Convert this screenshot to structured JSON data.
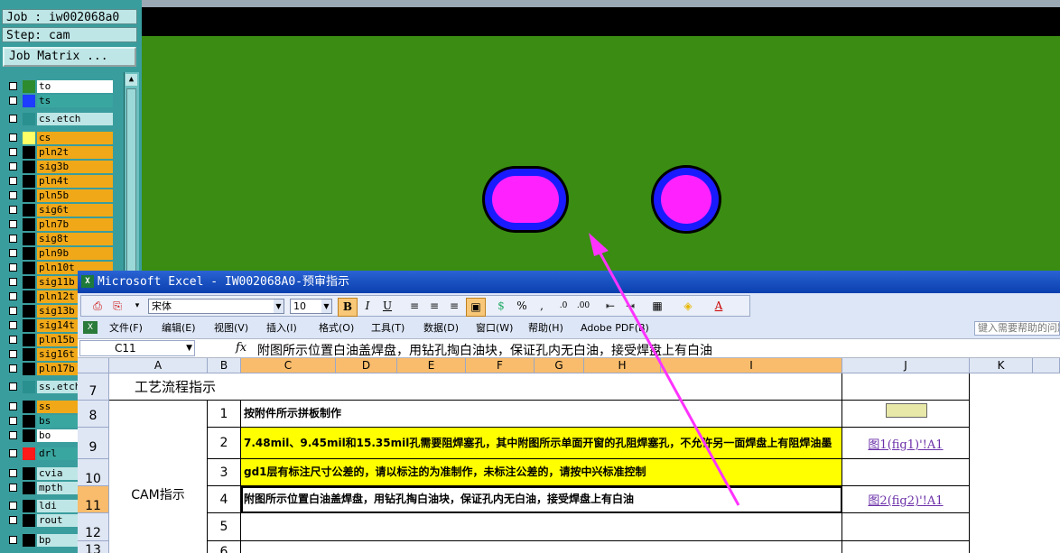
{
  "cam": {
    "job_label": "Job : iw002068a0",
    "step_label": "Step: cam",
    "job_matrix_button": "Job Matrix ...",
    "layers": [
      {
        "name": "to",
        "color": "#2e8b2e",
        "label_bg": "#ffffff",
        "group": 1
      },
      {
        "name": "ts",
        "color": "#1e3cff",
        "label_bg": "#3aa6a0",
        "group": 1
      },
      {
        "name": "cs.etch",
        "color": "#2a8f8f",
        "label_bg": "#bfe6e6",
        "group": 2
      },
      {
        "name": "cs",
        "color": "#ffff66",
        "label_bg": "#f0a818",
        "group": 3
      },
      {
        "name": "pln2t",
        "color": "#000000",
        "label_bg": "#f0a818",
        "group": 3
      },
      {
        "name": "sig3b",
        "color": "#000000",
        "label_bg": "#f0a818",
        "group": 3
      },
      {
        "name": "pln4t",
        "color": "#000000",
        "label_bg": "#f0a818",
        "group": 3
      },
      {
        "name": "pln5b",
        "color": "#000000",
        "label_bg": "#f0a818",
        "group": 3
      },
      {
        "name": "sig6t",
        "color": "#000000",
        "label_bg": "#f0a818",
        "group": 3
      },
      {
        "name": "pln7b",
        "color": "#000000",
        "label_bg": "#f0a818",
        "group": 3
      },
      {
        "name": "sig8t",
        "color": "#000000",
        "label_bg": "#f0a818",
        "group": 3
      },
      {
        "name": "pln9b",
        "color": "#000000",
        "label_bg": "#f0a818",
        "group": 3
      },
      {
        "name": "pln10t",
        "color": "#000000",
        "label_bg": "#f0a818",
        "group": 3
      },
      {
        "name": "sig11b",
        "color": "#000000",
        "label_bg": "#f0a818",
        "group": 3
      },
      {
        "name": "pln12t",
        "color": "#000000",
        "label_bg": "#f0a818",
        "group": 3
      },
      {
        "name": "sig13b",
        "color": "#000000",
        "label_bg": "#f0a818",
        "group": 3
      },
      {
        "name": "sig14t",
        "color": "#000000",
        "label_bg": "#f0a818",
        "group": 3
      },
      {
        "name": "pln15b",
        "color": "#000000",
        "label_bg": "#f0a818",
        "group": 3
      },
      {
        "name": "sig16t",
        "color": "#000000",
        "label_bg": "#f0a818",
        "group": 3
      },
      {
        "name": "pln17b",
        "color": "#000000",
        "label_bg": "#f0a818",
        "group": 3
      },
      {
        "name": "ss.etch",
        "color": "#2a8f8f",
        "label_bg": "#bfe6e6",
        "group": 4
      },
      {
        "name": "ss",
        "color": "#000000",
        "label_bg": "#f0a818",
        "group": 5
      },
      {
        "name": "bs",
        "color": "#000000",
        "label_bg": "#3aa6a0",
        "group": 5
      },
      {
        "name": "bo",
        "color": "#000000",
        "label_bg": "#ffffff",
        "group": 5
      },
      {
        "name": "drl",
        "color": "#ff1a1a",
        "label_bg": "#3aa6a0",
        "group": 6
      },
      {
        "name": "cvia",
        "color": "#000000",
        "label_bg": "#bfe6e6",
        "group": 7
      },
      {
        "name": "mpth",
        "color": "#000000",
        "label_bg": "#bfe6e6",
        "group": 7
      },
      {
        "name": "ldi",
        "color": "#000000",
        "label_bg": "#bfe6e6",
        "group": 8
      },
      {
        "name": "rout",
        "color": "#000000",
        "label_bg": "#bfe6e6",
        "group": 8
      },
      {
        "name": "bp",
        "color": "#000000",
        "label_bg": "#bfe6e6",
        "group": 9
      }
    ],
    "canvas_colors": {
      "board": "#3a8d12",
      "pad_outer": "#1a1aff",
      "pad_inner": "#ff22ff",
      "arrow": "#ff33ff"
    }
  },
  "excel": {
    "title": "Microsoft Excel - IW002068A0-预审指示",
    "font_name": "宋体",
    "font_size": "10",
    "menu": [
      "文件(F)",
      "编辑(E)",
      "视图(V)",
      "插入(I)",
      "格式(O)",
      "工具(T)",
      "数据(D)",
      "窗口(W)",
      "帮助(H)",
      "Adobe PDF(B)"
    ],
    "help_search_placeholder": "键入需要帮助的问题",
    "name_box": "C11",
    "fx": "fx",
    "formula": "附图所示位置白油盖焊盘，用钻孔掏白油块，保证孔内无白油，接受焊盘上有白油",
    "columns": [
      "A",
      "B",
      "C",
      "D",
      "E",
      "F",
      "G",
      "H",
      "I",
      "J",
      "K"
    ],
    "rows": [
      "7",
      "8",
      "9",
      "10",
      "11",
      "12",
      "13"
    ],
    "section_title": "工艺流程指示",
    "cam_label": "CAM指示",
    "items": [
      {
        "no": "1",
        "text": "按附件所示拼板制作",
        "yellow": false,
        "link": ""
      },
      {
        "no": "2",
        "text": "7.48mil、9.45mil和15.35mil孔需要阻焊塞孔，其中附图所示单面开窗的孔阻焊塞孔，不允许另一面焊盘上有阻焊油墨",
        "yellow": true,
        "link": "图1(fig1)'!A1"
      },
      {
        "no": "3",
        "text": "gd1层有标注尺寸公差的，请以标注的为准制作，未标注公差的，请按中兴标准控制",
        "yellow": true,
        "link": ""
      },
      {
        "no": "4",
        "text": "附图所示位置白油盖焊盘，用钻孔掏白油块，保证孔内无白油，接受焊盘上有白油",
        "yellow": false,
        "link": "图2(fig2)'!A1"
      },
      {
        "no": "5",
        "text": "",
        "yellow": false,
        "link": ""
      },
      {
        "no": "6",
        "text": "",
        "yellow": false,
        "link": ""
      }
    ]
  }
}
